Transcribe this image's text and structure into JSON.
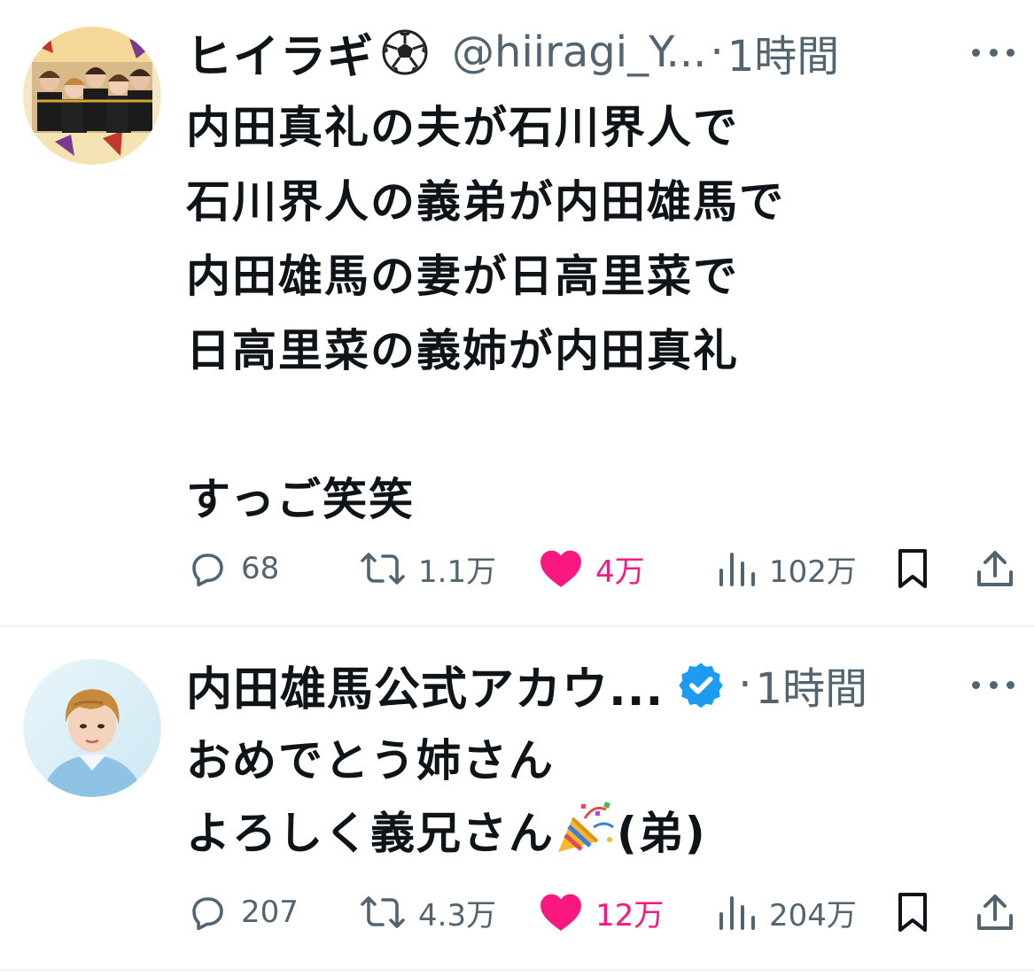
{
  "colors": {
    "text": "#0f1419",
    "muted": "#536471",
    "like": "#f91880",
    "verified": "#1d9bf0",
    "divider": "#eff3f4"
  },
  "tweets": [
    {
      "author": "ヒイラギ",
      "author_emoji": "soccer-ball-icon",
      "handle": "@hiiragi_Y...",
      "dot": "·",
      "time": "1時間",
      "lines": [
        "内田真礼の夫が石川界人で",
        "石川界人の義弟が内田雄馬で",
        "内田雄馬の妻が日高里菜で",
        "日高里菜の義姉が内田真礼",
        "",
        "すっご笑笑"
      ],
      "replies": "68",
      "retweets": "1.1万",
      "likes": "4万",
      "views": "102万"
    },
    {
      "author": "内田雄馬公式アカウ...",
      "verified": true,
      "dot": "·",
      "time": "1時間",
      "line1": "おめでとう姉さん",
      "line2_before": "よろしく義兄さん",
      "line2_emoji": "party-popper-icon",
      "line2_after": "(弟)",
      "replies": "207",
      "retweets": "4.3万",
      "likes": "12万",
      "views": "204万"
    }
  ]
}
